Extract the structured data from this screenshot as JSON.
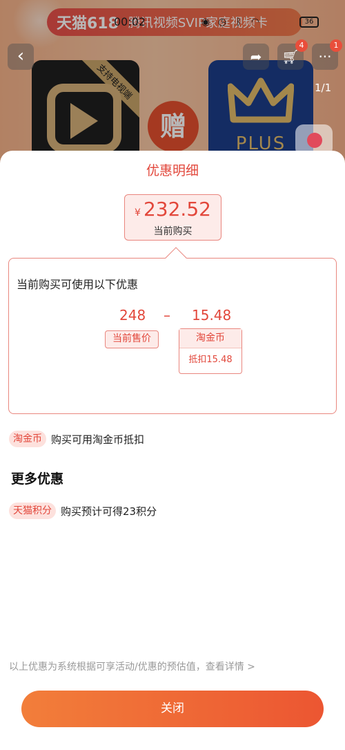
{
  "statusbar": {
    "time": "00:02",
    "battery": "36"
  },
  "banner": {
    "brand": "天猫618",
    "text": "腾讯视频SVIP家庭视频卡"
  },
  "product_page": {
    "cart_badge": "4",
    "message_badge": "1",
    "page_indicator": "1/1",
    "ribbon_text": "支持电视端",
    "gift_text": "赠",
    "plus_text": "PLUS"
  },
  "sheet": {
    "title": "优惠明细",
    "current_price": {
      "currency": "¥",
      "amount": "232.52",
      "label": "当前购买"
    },
    "detail": {
      "heading": "当前购买可使用以下优惠",
      "original_price": "248",
      "operator": "–",
      "discount_value": "15.48",
      "original_price_tag": "当前售价",
      "coin_tag_title": "淘金币",
      "coin_tag_desc": "抵扣15.48"
    },
    "coin_row": {
      "pill": "淘金币",
      "text": "购买可用淘金币抵扣"
    },
    "more_title": "更多优惠",
    "points_row": {
      "pill": "天猫积分",
      "text": "购买预计可得23积分"
    },
    "footnote": "以上优惠为系统根据可享活动/优惠的预估值，查看详情 >",
    "close_label": "关闭"
  },
  "colors": {
    "accent": "#e2473b",
    "button_gradient_start": "#f27e3a",
    "button_gradient_end": "#ec5632"
  }
}
